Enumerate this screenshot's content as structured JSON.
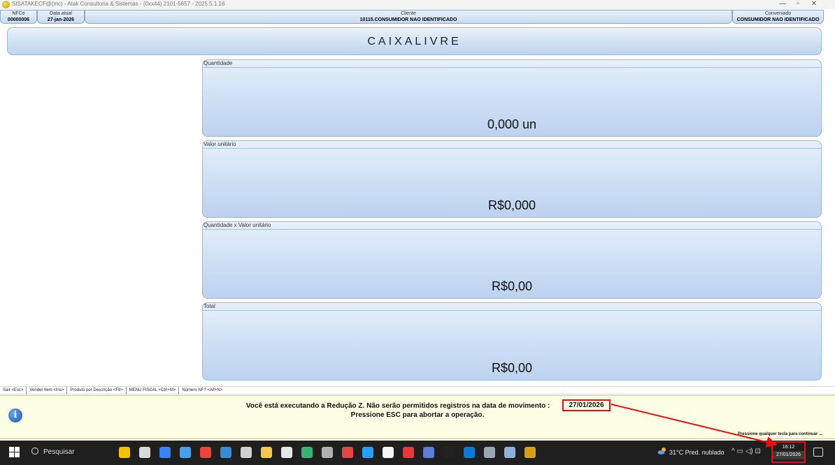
{
  "window": {
    "title": "SISATAKECF@(mc) - Atak Consultoria & Sistemas - (0xx44) 2101-5657 - 2025.5.1.16",
    "minimize": "—",
    "maximize": "▫",
    "close": "✕"
  },
  "header": {
    "nfce_label": "NFCe",
    "nfce_value": "00000006",
    "date_label": "Data atual",
    "date_value": "27-jan-2026",
    "client_label": "Cliente",
    "client_value": "10115.CONSUMIDOR  NAO IDENTIFICADO",
    "conveniado_label": "Conveniado",
    "conveniado_value": "CONSUMIDOR  NAO IDENTIFICADO"
  },
  "banner": {
    "text": "CAIXALIVRE"
  },
  "panels": [
    {
      "label": "Quantidade",
      "value": "0,000 un"
    },
    {
      "label": "Valor unitário",
      "value": "R$0,000"
    },
    {
      "label": "Quantidade x Valor unitário",
      "value": "R$0,00"
    },
    {
      "label": "Total",
      "value": "R$0,00"
    }
  ],
  "shortcuts": [
    "Sair <Esc>",
    "Vender Item <Ins>",
    "Produto por Descrição <F9>",
    "MENU FISCAL <Ctrl+M>",
    "Número NF? <Alt+N>"
  ],
  "message": {
    "line1": "Você está executando a Redução Z. Não serão permitidos registros na data de movimento :",
    "date": "27/01/2026",
    "line2": "Pressione ESC para abortar a operação.",
    "continue": "Pressione qualquer tecla para continuar ..."
  },
  "taskbar": {
    "search_placeholder": "Pesquisar",
    "weather": "31°C  Pred. nublado",
    "time": "16:12",
    "date": "27/01/2026",
    "icon_colors": [
      "#f2c400",
      "#d9d9d9",
      "#3b82f6",
      "#4aa0e8",
      "#e8453c",
      "#3a8bd6",
      "#d0d0d0",
      "#f2c94c",
      "#e6e6e6",
      "#3cb371",
      "#b0b0b0",
      "#e04848",
      "#2a9df4",
      "#f5f5f5",
      "#e23b3b",
      "#5b7fd6",
      "#222222",
      "#0b7bd6",
      "#9aa7b4",
      "#8fb0d8",
      "#d4a017"
    ]
  },
  "colors": {
    "panel_border": "#9db8dc",
    "highlight": "#e31212",
    "message_bg": "#fefee4",
    "taskbar_bg": "#1f1f1f"
  }
}
